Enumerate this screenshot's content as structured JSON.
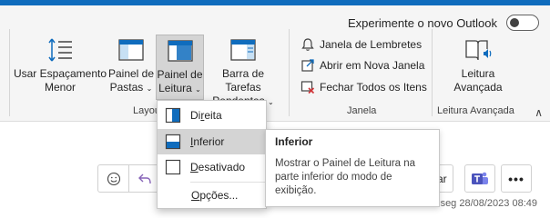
{
  "try_outlook": {
    "label": "Experimente o novo Outlook"
  },
  "layout_group": {
    "label": "Layout",
    "label_visible": "Layou",
    "usar_espacamento": {
      "line1": "Usar Espaçamento",
      "line2": "Menor"
    },
    "painel_pastas": {
      "line1": "Painel de",
      "line2": "Pastas"
    },
    "painel_leitura": {
      "line1": "Painel de",
      "line2": "Leitura"
    },
    "barra_tarefas": {
      "line1": "Barra de Tarefas",
      "line2": "Pendentes"
    }
  },
  "janela_group": {
    "label": "Janela",
    "items": [
      "Janela de Lembretes",
      "Abrir em Nova Janela",
      "Fechar Todos os Itens"
    ]
  },
  "leitura_group": {
    "label": "Leitura Avançada",
    "button": {
      "line1": "Leitura",
      "line2": "Avançada"
    }
  },
  "dropdown": {
    "items": [
      {
        "pre": "Di",
        "u": "r",
        "post": "eita"
      },
      {
        "pre": "",
        "u": "I",
        "post": "nferior"
      },
      {
        "pre": "",
        "u": "D",
        "post": "esativado"
      }
    ],
    "options": {
      "pre": "",
      "u": "O",
      "post": "pções..."
    }
  },
  "tooltip": {
    "title": "Inferior",
    "body": "Mostrar o Painel de Leitura na parte inferior do modo de exibição."
  },
  "message_bar": {
    "reply_all_partial": "ar",
    "timestamp": "seg 28/08/2023 08:49"
  }
}
